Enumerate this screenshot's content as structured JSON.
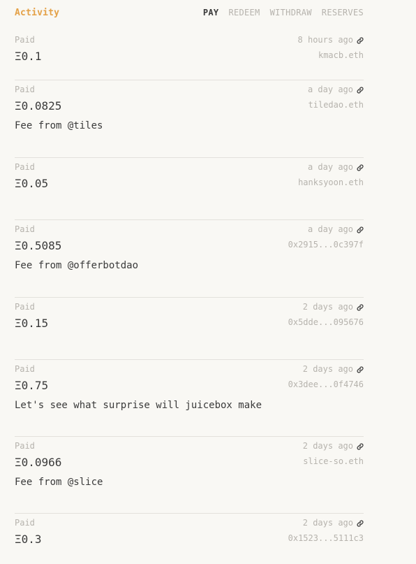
{
  "header": {
    "title": "Activity",
    "tabs": [
      {
        "label": "PAY",
        "active": true
      },
      {
        "label": "REDEEM",
        "active": false
      },
      {
        "label": "WITHDRAW",
        "active": false
      },
      {
        "label": "RESERVES",
        "active": false
      }
    ]
  },
  "icons": {
    "link": "link-icon"
  },
  "activity": [
    {
      "label": "Paid",
      "amount": "Ξ0.1",
      "time": "8 hours ago",
      "who": "kmacb.eth",
      "note": ""
    },
    {
      "label": "Paid",
      "amount": "Ξ0.0825",
      "time": "a day ago",
      "who": "tiledao.eth",
      "note": "Fee from @tiles"
    },
    {
      "label": "Paid",
      "amount": "Ξ0.05",
      "time": "a day ago",
      "who": "hanksyoon.eth",
      "note": ""
    },
    {
      "label": "Paid",
      "amount": "Ξ0.5085",
      "time": "a day ago",
      "who": "0x2915...0c397f",
      "note": "Fee from @offerbotdao"
    },
    {
      "label": "Paid",
      "amount": "Ξ0.15",
      "time": "2 days ago",
      "who": "0x5dde...095676",
      "note": ""
    },
    {
      "label": "Paid",
      "amount": "Ξ0.75",
      "time": "2 days ago",
      "who": "0x3dee...0f4746",
      "note": "Let's see what surprise will juicebox make"
    },
    {
      "label": "Paid",
      "amount": "Ξ0.0966",
      "time": "2 days ago",
      "who": "slice-so.eth",
      "note": "Fee from @slice"
    },
    {
      "label": "Paid",
      "amount": "Ξ0.3",
      "time": "2 days ago",
      "who": "0x1523...5111c3",
      "note": ""
    }
  ],
  "colors": {
    "background": "#f9f8f4",
    "accent": "#e4a147",
    "muted": "#b6b3ad",
    "text": "#3a3a3a",
    "divider": "#e3e1dc"
  }
}
